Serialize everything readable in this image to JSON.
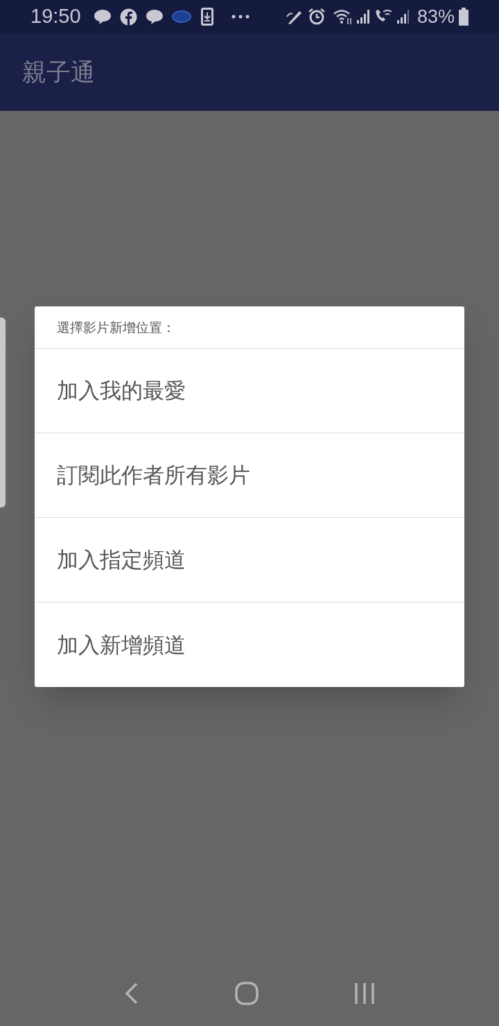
{
  "status_bar": {
    "time": "19:50",
    "battery": "83%"
  },
  "app_bar": {
    "title": "親子通"
  },
  "dialog": {
    "title": "選擇影片新增位置：",
    "items": [
      {
        "label": "加入我的最愛"
      },
      {
        "label": "訂閱此作者所有影片"
      },
      {
        "label": "加入指定頻道"
      },
      {
        "label": "加入新增頻道"
      }
    ]
  }
}
